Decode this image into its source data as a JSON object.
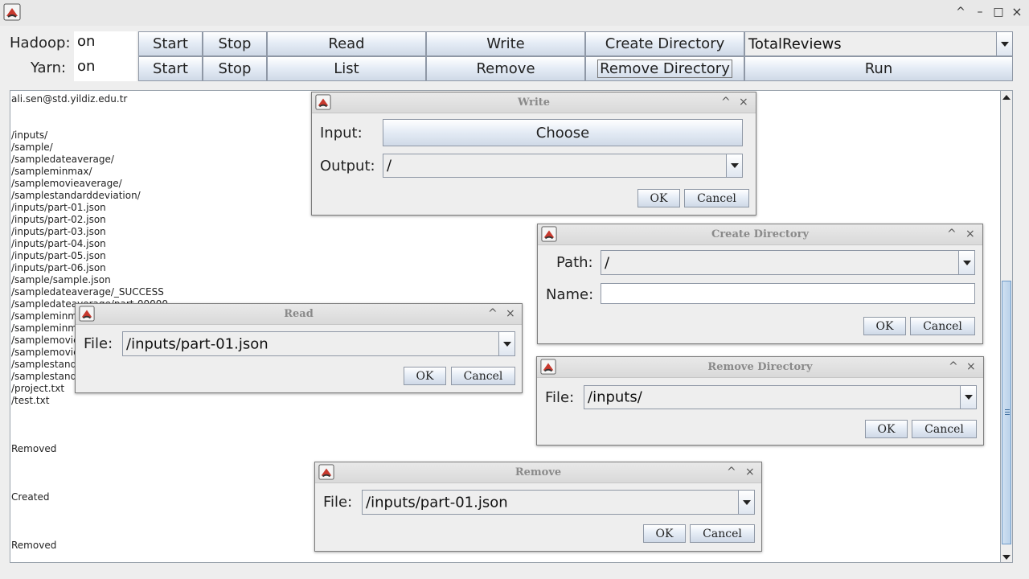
{
  "window": {
    "controls": {
      "minimize_chevron": "^",
      "minimize": "–",
      "maximize": "□",
      "close": "×"
    }
  },
  "toolbar": {
    "hadoop_label": "Hadoop:",
    "hadoop_status": "on",
    "yarn_label": "Yarn:",
    "yarn_status": "on",
    "row1_buttons": [
      "Start",
      "Stop",
      "Read",
      "Write",
      "Create Directory"
    ],
    "row2_buttons": [
      "Start",
      "Stop",
      "List",
      "Remove",
      "Remove Directory"
    ],
    "job_select": "TotalReviews",
    "run_button": "Run"
  },
  "output": {
    "lines": [
      "ali.sen@std.yildiz.edu.tr",
      "",
      "",
      "/inputs/",
      "/sample/",
      "/sampledateaverage/",
      "/sampleminmax/",
      "/samplemovieaverage/",
      "/samplestandarddeviation/",
      "/inputs/part-01.json",
      "/inputs/part-02.json",
      "/inputs/part-03.json",
      "/inputs/part-04.json",
      "/inputs/part-05.json",
      "/inputs/part-06.json",
      "/sample/sample.json",
      "/sampledateaverage/_SUCCESS",
      "/sampledateaverage/part-00000",
      "/sampleminm",
      "/sampleminm",
      "/samplemovie",
      "/samplemovie",
      "/samplestand",
      "/samplestand",
      "/project.txt",
      "/test.txt",
      "",
      "",
      "",
      "Removed",
      "",
      "",
      "",
      "Created",
      "",
      "",
      "",
      "Removed"
    ]
  },
  "dialogs": {
    "write": {
      "title": "Write",
      "input_label": "Input:",
      "choose_button": "Choose",
      "output_label": "Output:",
      "output_value": "/",
      "ok": "OK",
      "cancel": "Cancel"
    },
    "create_directory": {
      "title": "Create Directory",
      "path_label": "Path:",
      "path_value": "/",
      "name_label": "Name:",
      "name_value": "",
      "ok": "OK",
      "cancel": "Cancel"
    },
    "read": {
      "title": "Read",
      "file_label": "File:",
      "file_value": "/inputs/part-01.json",
      "ok": "OK",
      "cancel": "Cancel"
    },
    "remove_directory": {
      "title": "Remove Directory",
      "file_label": "File:",
      "file_value": "/inputs/",
      "ok": "OK",
      "cancel": "Cancel"
    },
    "remove": {
      "title": "Remove",
      "file_label": "File:",
      "file_value": "/inputs/part-01.json",
      "ok": "OK",
      "cancel": "Cancel"
    }
  }
}
